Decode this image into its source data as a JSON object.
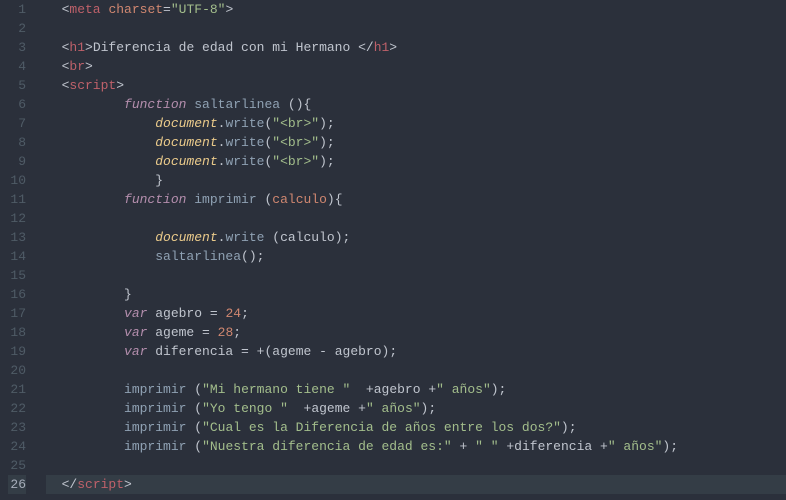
{
  "activeLine": 26,
  "lines": [
    {
      "n": 1,
      "tokens": [
        {
          "c": "c-punct",
          "t": "  <"
        },
        {
          "c": "c-tag",
          "t": "meta"
        },
        {
          "c": "c-text",
          "t": " "
        },
        {
          "c": "c-attr",
          "t": "charset"
        },
        {
          "c": "c-punct",
          "t": "="
        },
        {
          "c": "c-string",
          "t": "\"UTF-8\""
        },
        {
          "c": "c-punct",
          "t": ">"
        }
      ]
    },
    {
      "n": 2,
      "tokens": []
    },
    {
      "n": 3,
      "tokens": [
        {
          "c": "c-punct",
          "t": "  <"
        },
        {
          "c": "c-tag",
          "t": "h1"
        },
        {
          "c": "c-punct",
          "t": ">"
        },
        {
          "c": "c-text",
          "t": "Diferencia de edad con mi Hermano "
        },
        {
          "c": "c-punct",
          "t": "</"
        },
        {
          "c": "c-tag",
          "t": "h1"
        },
        {
          "c": "c-punct",
          "t": ">"
        }
      ]
    },
    {
      "n": 4,
      "tokens": [
        {
          "c": "c-punct",
          "t": "  <"
        },
        {
          "c": "c-tag",
          "t": "br"
        },
        {
          "c": "c-punct",
          "t": ">"
        }
      ]
    },
    {
      "n": 5,
      "tokens": [
        {
          "c": "c-punct",
          "t": "  <"
        },
        {
          "c": "c-tag",
          "t": "script"
        },
        {
          "c": "c-punct",
          "t": ">"
        }
      ]
    },
    {
      "n": 6,
      "tokens": [
        {
          "c": "c-text",
          "t": "          "
        },
        {
          "c": "c-kw",
          "t": "function"
        },
        {
          "c": "c-text",
          "t": " "
        },
        {
          "c": "c-fn",
          "t": "saltarlinea"
        },
        {
          "c": "c-text",
          "t": " "
        },
        {
          "c": "c-punct",
          "t": "(){"
        }
      ]
    },
    {
      "n": 7,
      "tokens": [
        {
          "c": "c-text",
          "t": "              "
        },
        {
          "c": "c-obj",
          "t": "document"
        },
        {
          "c": "c-punct",
          "t": "."
        },
        {
          "c": "c-fn",
          "t": "write"
        },
        {
          "c": "c-punct",
          "t": "("
        },
        {
          "c": "c-string",
          "t": "\"<br>\""
        },
        {
          "c": "c-punct",
          "t": ");"
        }
      ]
    },
    {
      "n": 8,
      "tokens": [
        {
          "c": "c-text",
          "t": "              "
        },
        {
          "c": "c-obj",
          "t": "document"
        },
        {
          "c": "c-punct",
          "t": "."
        },
        {
          "c": "c-fn",
          "t": "write"
        },
        {
          "c": "c-punct",
          "t": "("
        },
        {
          "c": "c-string",
          "t": "\"<br>\""
        },
        {
          "c": "c-punct",
          "t": ");"
        }
      ]
    },
    {
      "n": 9,
      "tokens": [
        {
          "c": "c-text",
          "t": "              "
        },
        {
          "c": "c-obj",
          "t": "document"
        },
        {
          "c": "c-punct",
          "t": "."
        },
        {
          "c": "c-fn",
          "t": "write"
        },
        {
          "c": "c-punct",
          "t": "("
        },
        {
          "c": "c-string",
          "t": "\"<br>\""
        },
        {
          "c": "c-punct",
          "t": ");"
        }
      ]
    },
    {
      "n": 10,
      "tokens": [
        {
          "c": "c-text",
          "t": "              "
        },
        {
          "c": "c-punct",
          "t": "}"
        }
      ]
    },
    {
      "n": 11,
      "tokens": [
        {
          "c": "c-text",
          "t": "          "
        },
        {
          "c": "c-kw",
          "t": "function"
        },
        {
          "c": "c-text",
          "t": " "
        },
        {
          "c": "c-fn",
          "t": "imprimir"
        },
        {
          "c": "c-text",
          "t": " "
        },
        {
          "c": "c-punct",
          "t": "("
        },
        {
          "c": "c-param",
          "t": "calculo"
        },
        {
          "c": "c-punct",
          "t": "){"
        }
      ]
    },
    {
      "n": 12,
      "tokens": []
    },
    {
      "n": 13,
      "tokens": [
        {
          "c": "c-text",
          "t": "              "
        },
        {
          "c": "c-obj",
          "t": "document"
        },
        {
          "c": "c-punct",
          "t": "."
        },
        {
          "c": "c-fn",
          "t": "write"
        },
        {
          "c": "c-text",
          "t": " "
        },
        {
          "c": "c-punct",
          "t": "("
        },
        {
          "c": "c-text",
          "t": "calculo"
        },
        {
          "c": "c-punct",
          "t": ");"
        }
      ]
    },
    {
      "n": 14,
      "tokens": [
        {
          "c": "c-text",
          "t": "              "
        },
        {
          "c": "c-fn",
          "t": "saltarlinea"
        },
        {
          "c": "c-punct",
          "t": "();"
        }
      ]
    },
    {
      "n": 15,
      "tokens": []
    },
    {
      "n": 16,
      "tokens": [
        {
          "c": "c-text",
          "t": "          "
        },
        {
          "c": "c-punct",
          "t": "}"
        }
      ]
    },
    {
      "n": 17,
      "tokens": [
        {
          "c": "c-text",
          "t": "          "
        },
        {
          "c": "c-kw",
          "t": "var"
        },
        {
          "c": "c-text",
          "t": " agebro "
        },
        {
          "c": "c-op",
          "t": "="
        },
        {
          "c": "c-text",
          "t": " "
        },
        {
          "c": "c-num",
          "t": "24"
        },
        {
          "c": "c-punct",
          "t": ";"
        }
      ]
    },
    {
      "n": 18,
      "tokens": [
        {
          "c": "c-text",
          "t": "          "
        },
        {
          "c": "c-kw",
          "t": "var"
        },
        {
          "c": "c-text",
          "t": " ageme "
        },
        {
          "c": "c-op",
          "t": "="
        },
        {
          "c": "c-text",
          "t": " "
        },
        {
          "c": "c-num",
          "t": "28"
        },
        {
          "c": "c-punct",
          "t": ";"
        }
      ]
    },
    {
      "n": 19,
      "tokens": [
        {
          "c": "c-text",
          "t": "          "
        },
        {
          "c": "c-kw",
          "t": "var"
        },
        {
          "c": "c-text",
          "t": " diferencia "
        },
        {
          "c": "c-op",
          "t": "="
        },
        {
          "c": "c-text",
          "t": " "
        },
        {
          "c": "c-op",
          "t": "+"
        },
        {
          "c": "c-punct",
          "t": "("
        },
        {
          "c": "c-text",
          "t": "ageme "
        },
        {
          "c": "c-op",
          "t": "-"
        },
        {
          "c": "c-text",
          "t": " agebro"
        },
        {
          "c": "c-punct",
          "t": ");"
        }
      ]
    },
    {
      "n": 20,
      "tokens": []
    },
    {
      "n": 21,
      "tokens": [
        {
          "c": "c-text",
          "t": "          "
        },
        {
          "c": "c-fn",
          "t": "imprimir"
        },
        {
          "c": "c-text",
          "t": " "
        },
        {
          "c": "c-punct",
          "t": "("
        },
        {
          "c": "c-string",
          "t": "\"Mi hermano tiene \""
        },
        {
          "c": "c-text",
          "t": "  "
        },
        {
          "c": "c-op",
          "t": "+"
        },
        {
          "c": "c-text",
          "t": "agebro "
        },
        {
          "c": "c-op",
          "t": "+"
        },
        {
          "c": "c-string",
          "t": "\" años\""
        },
        {
          "c": "c-punct",
          "t": ");"
        }
      ]
    },
    {
      "n": 22,
      "tokens": [
        {
          "c": "c-text",
          "t": "          "
        },
        {
          "c": "c-fn",
          "t": "imprimir"
        },
        {
          "c": "c-text",
          "t": " "
        },
        {
          "c": "c-punct",
          "t": "("
        },
        {
          "c": "c-string",
          "t": "\"Yo tengo \""
        },
        {
          "c": "c-text",
          "t": "  "
        },
        {
          "c": "c-op",
          "t": "+"
        },
        {
          "c": "c-text",
          "t": "ageme "
        },
        {
          "c": "c-op",
          "t": "+"
        },
        {
          "c": "c-string",
          "t": "\" años\""
        },
        {
          "c": "c-punct",
          "t": ");"
        }
      ]
    },
    {
      "n": 23,
      "tokens": [
        {
          "c": "c-text",
          "t": "          "
        },
        {
          "c": "c-fn",
          "t": "imprimir"
        },
        {
          "c": "c-text",
          "t": " "
        },
        {
          "c": "c-punct",
          "t": "("
        },
        {
          "c": "c-string",
          "t": "\"Cual es la Diferencia de años entre los dos?\""
        },
        {
          "c": "c-punct",
          "t": ");"
        }
      ]
    },
    {
      "n": 24,
      "tokens": [
        {
          "c": "c-text",
          "t": "          "
        },
        {
          "c": "c-fn",
          "t": "imprimir"
        },
        {
          "c": "c-text",
          "t": " "
        },
        {
          "c": "c-punct",
          "t": "("
        },
        {
          "c": "c-string",
          "t": "\"Nuestra diferencia de edad es:\""
        },
        {
          "c": "c-text",
          "t": " "
        },
        {
          "c": "c-op",
          "t": "+"
        },
        {
          "c": "c-text",
          "t": " "
        },
        {
          "c": "c-string",
          "t": "\" \""
        },
        {
          "c": "c-text",
          "t": " "
        },
        {
          "c": "c-op",
          "t": "+"
        },
        {
          "c": "c-text",
          "t": "diferencia "
        },
        {
          "c": "c-op",
          "t": "+"
        },
        {
          "c": "c-string",
          "t": "\" años\""
        },
        {
          "c": "c-punct",
          "t": ");"
        }
      ]
    },
    {
      "n": 25,
      "tokens": []
    },
    {
      "n": 26,
      "tokens": [
        {
          "c": "c-punct",
          "t": "  </"
        },
        {
          "c": "c-tag",
          "t": "script"
        },
        {
          "c": "c-punct",
          "t": ">"
        }
      ]
    }
  ]
}
